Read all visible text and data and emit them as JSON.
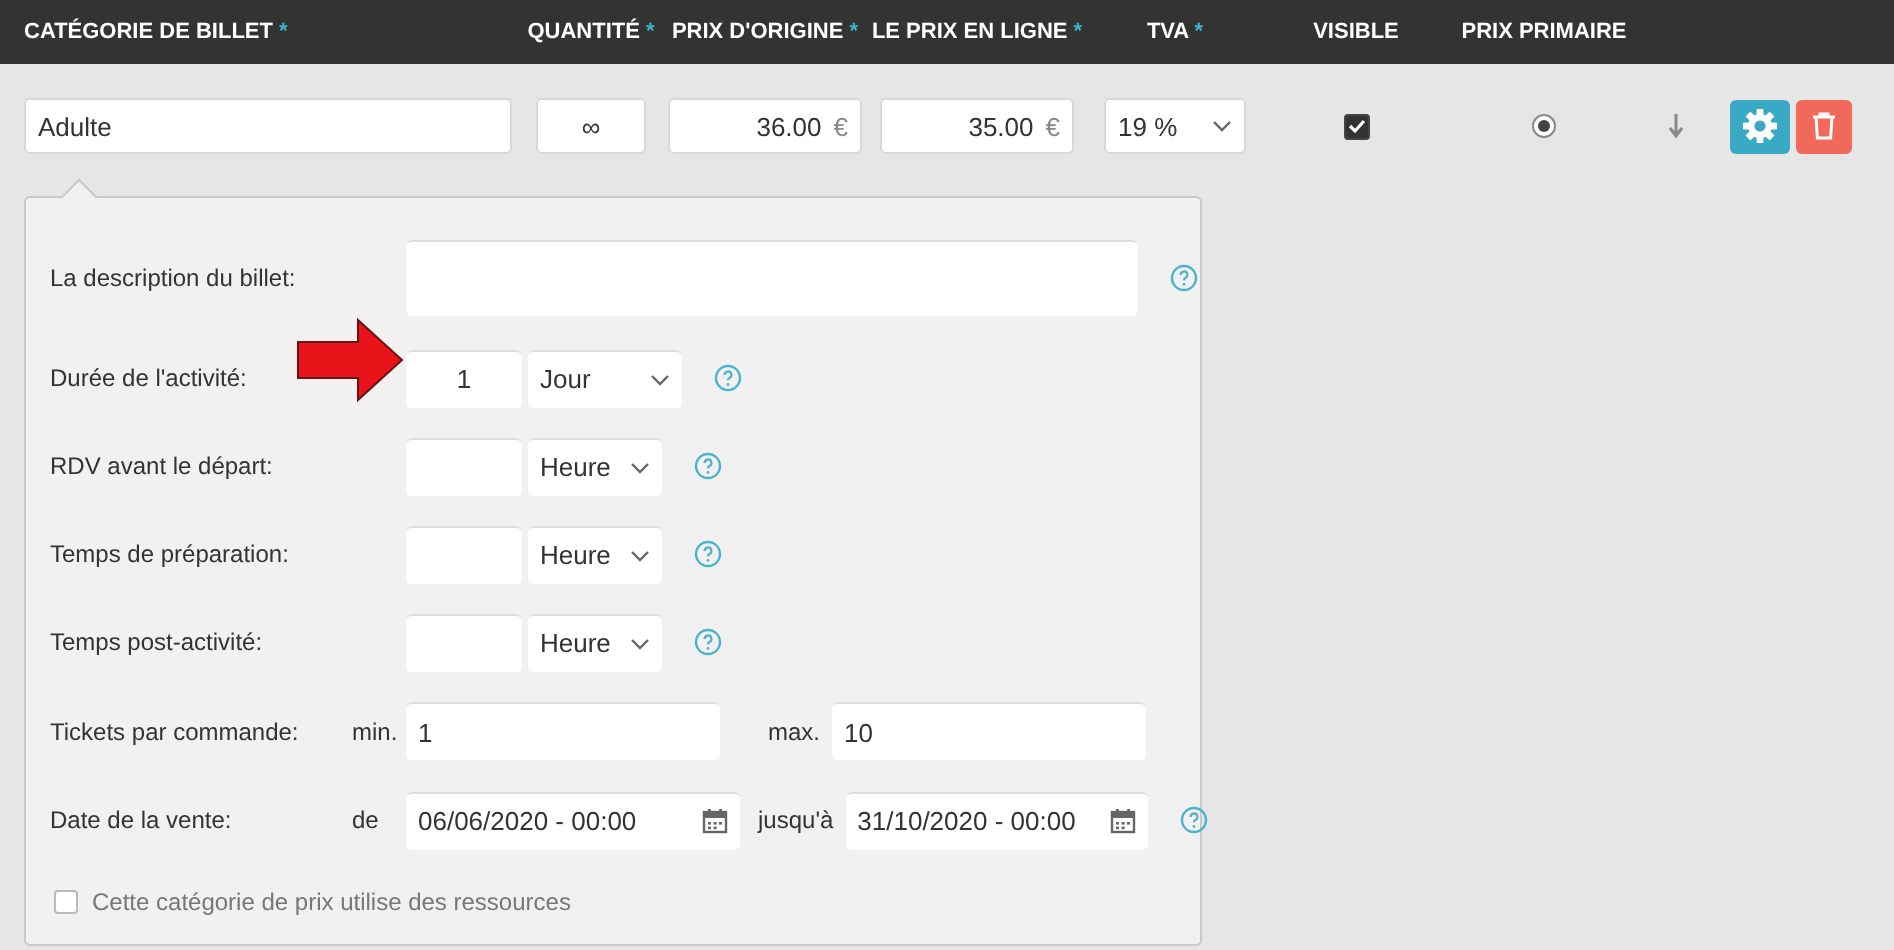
{
  "header": {
    "columns": [
      {
        "label": "CATÉGORIE DE BILLET",
        "mark": "*"
      },
      {
        "label": "QUANTITÉ",
        "mark": "*"
      },
      {
        "label": "PRIX D'ORIGINE",
        "mark": "*"
      },
      {
        "label": "LE PRIX EN LIGNE",
        "mark": "*"
      },
      {
        "label": "TVA",
        "mark": "*"
      },
      {
        "label": "VISIBLE"
      },
      {
        "label": "PRIX PRIMAIRE"
      }
    ]
  },
  "ticket": {
    "name": "Adulte",
    "quantity": "∞",
    "original_price": "36.00",
    "online_price": "35.00",
    "currency": "€",
    "vat": "19 %",
    "visible": true,
    "primary": true
  },
  "details": {
    "rows": [
      {
        "kind": "textarea",
        "label": "La description du billet:",
        "help": true
      },
      {
        "kind": "duration",
        "label": "Durée de l'activité:",
        "value": "1",
        "unit": "Jour",
        "help": true,
        "pointer": true
      },
      {
        "kind": "duration",
        "label": "RDV avant le départ:",
        "unit": "Heure",
        "help": true,
        "pointer": false
      },
      {
        "kind": "duration",
        "label": "Temps de préparation:",
        "unit": "Heure",
        "help": true,
        "pointer": false
      },
      {
        "kind": "duration",
        "label": "Temps post-activité:",
        "unit": "Heure",
        "help": true,
        "pointer": false
      },
      {
        "kind": "range",
        "label": "Tickets par commande:",
        "from_label": "min.",
        "from": "1",
        "to_label": "max.",
        "to": "10",
        "help": false
      },
      {
        "kind": "daterange",
        "label": "Date de la vente:",
        "from_label": "de",
        "from": "06/06/2020 - 00:00",
        "to_label": "jusqu'à",
        "to": "31/10/2020 - 00:00",
        "help": true
      }
    ],
    "resources": {
      "label": "Cette catégorie de prix utilise des ressources",
      "checked": false
    }
  }
}
